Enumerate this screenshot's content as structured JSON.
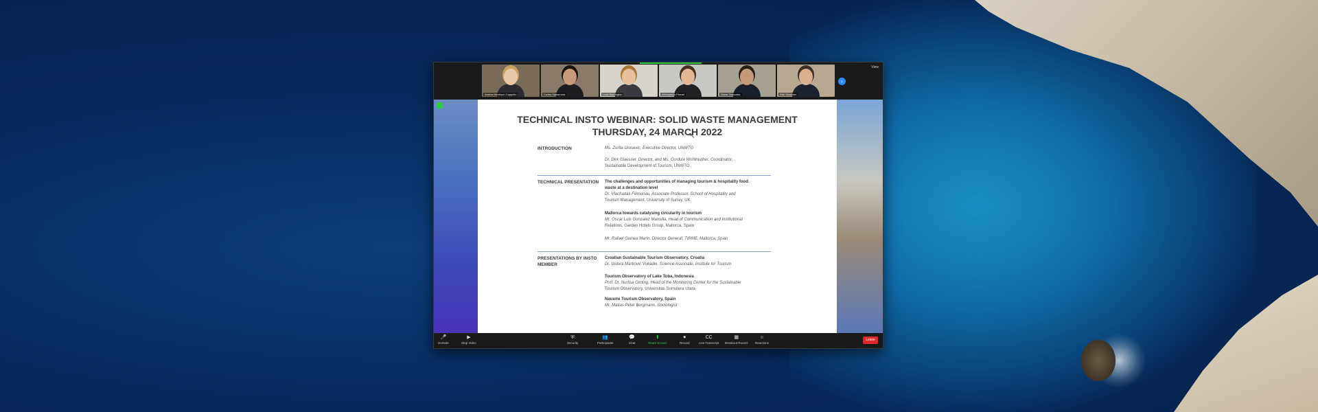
{
  "desktop": {
    "description_colors": {
      "sea": "#072a5c",
      "shallow": "#1a8fc4",
      "cliff": "#c9bda8"
    }
  },
  "zoom": {
    "participants": [
      {
        "name": "Andrea Morrison Cappello",
        "bg": "#7a6a58",
        "skin": "#e8c8a8",
        "hair": "#c9a060",
        "shirt": "#2a2a30"
      },
      {
        "name": "Cortez Nakamura",
        "bg": "#8a7a6a",
        "skin": "#c89a7a",
        "hair": "#1a1410",
        "shirt": "#1e1e22"
      },
      {
        "name": "Leah Barrington",
        "bg": "#d8d4cc",
        "skin": "#e8c0a0",
        "hair": "#a87838",
        "shirt": "#3a3a40"
      },
      {
        "name": "Alessandra Ferrari",
        "bg": "#c8c8c4",
        "skin": "#e0b898",
        "hair": "#4a3020",
        "shirt": "#222226"
      },
      {
        "name": "Oscar Gonzalez",
        "bg": "#a8a090",
        "skin": "#c89878",
        "hair": "#2a2018",
        "shirt": "#18202c"
      },
      {
        "name": "Dirk Glaesser",
        "bg": "#b8a890",
        "skin": "#d8b090",
        "hair": "#3a3028",
        "shirt": "#1c2230"
      }
    ],
    "gallery_next": "›",
    "view_label": "View",
    "toolbar": {
      "unmute": {
        "icon": "🎤",
        "label": "Unmute"
      },
      "video": {
        "icon": "▶",
        "label": "Stop Video"
      },
      "security": {
        "icon": "⛨",
        "label": "Security"
      },
      "participants": {
        "icon": "👥",
        "label": "Participants"
      },
      "chat": {
        "icon": "💬",
        "label": "Chat"
      },
      "share": {
        "icon": "⬆",
        "label": "Share Screen"
      },
      "record": {
        "icon": "⏺",
        "label": "Record"
      },
      "transcript": {
        "icon": "CC",
        "label": "Live Transcript"
      },
      "breakout": {
        "icon": "▦",
        "label": "Breakout Rooms"
      },
      "reactions": {
        "icon": "☺",
        "label": "Reactions"
      },
      "end": "Leave"
    }
  },
  "document": {
    "title_line1": "TECHNICAL INSTO WEBINAR: SOLID WASTE MANAGEMENT",
    "title_line2": "THURSDAY, 24 MARCH 2022",
    "sections": {
      "introduction": "INTRODUCTION",
      "technical": "TECHNICAL PRESENTATION",
      "presentations_1": "PRESENTATIONS BY INSTO",
      "presentations_2": "MEMBER"
    },
    "intro_1": "Ms. Zurita Urosevic, Executive Director, UNWTO",
    "intro_2a": "Dr. Dirk Glaesser, Director, and Ms. Cordula Wohlmuther, Coordinator,",
    "intro_2b": "Sustainable Development of Tourism, UNWTO",
    "tech_1_title_a": "The challenges and opportunities of managing tourism & hospitality food",
    "tech_1_title_b": "waste at a destination level",
    "tech_1_sp_a": "Dr. Vlachadas Filimonau, Associate Professor, School of Hospitality and",
    "tech_1_sp_b": "Tourism Management, University of Surrey, UK",
    "tech_2_title": "Mallorca towards catalysing circularity in tourism",
    "tech_2_sp_a": "Mr. Oscar Luis Gonzalez Mansilla, Head of Communication and Institutional",
    "tech_2_sp_b": "Relations, Garden Hotels Group, Mallorca, Spain",
    "tech_3_sp": "Mr. Rafael Guinea Marín, Director General, TIRME, Mallorca, Spain",
    "m_1_title": "Croatian Sustainable Tourism Observatory, Croatia",
    "m_1_sp": "Dr. Izidora Marković Vukadin, Science Associate, Institute for Tourism",
    "m_2_title": "Tourism Observatory of Lake Toba, Indonesia",
    "m_2_sp_a": "Prof. Dr. Nurlisa Ginting, Head of the Monitoring Center for the Sustainable",
    "m_2_sp_b": "Tourism Observatory, Universitas Sumatera Utara",
    "m_3_title": "Navarre Tourism Observatory, Spain",
    "m_3_sp": "Mr. Matias Peter Bergmann, Sociologist"
  }
}
